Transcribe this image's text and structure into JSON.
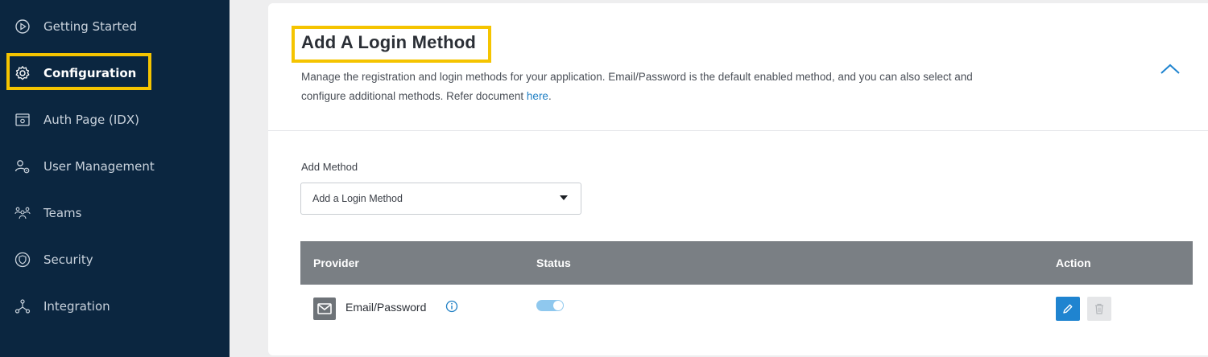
{
  "sidebar": {
    "items": [
      {
        "label": "Getting Started",
        "icon": "play-circle-icon"
      },
      {
        "label": "Configuration",
        "icon": "gear-icon",
        "active": true
      },
      {
        "label": "Auth Page (IDX)",
        "icon": "auth-page-icon"
      },
      {
        "label": "User Management",
        "icon": "user-gear-icon"
      },
      {
        "label": "Teams",
        "icon": "teams-icon"
      },
      {
        "label": "Security",
        "icon": "shield-icon"
      },
      {
        "label": "Integration",
        "icon": "integration-icon"
      }
    ]
  },
  "section": {
    "title": "Add A Login Method",
    "description": "Manage the registration and login methods for your application. Email/Password is the default enabled method, and you can also select and configure additional methods. Refer document ",
    "link_text": "here",
    "description_end": "."
  },
  "form": {
    "label": "Add Method",
    "select_value": "Add a Login Method"
  },
  "table": {
    "headers": {
      "provider": "Provider",
      "status": "Status",
      "action": "Action"
    },
    "rows": [
      {
        "provider": "Email/Password",
        "provider_icon": "mail-icon",
        "status_enabled": true
      }
    ]
  },
  "colors": {
    "sidebar_bg": "#0b2640",
    "highlight": "#f5c400",
    "link": "#1f7fc4",
    "edit_button": "#1f84d0",
    "table_header": "#7a7f84"
  }
}
